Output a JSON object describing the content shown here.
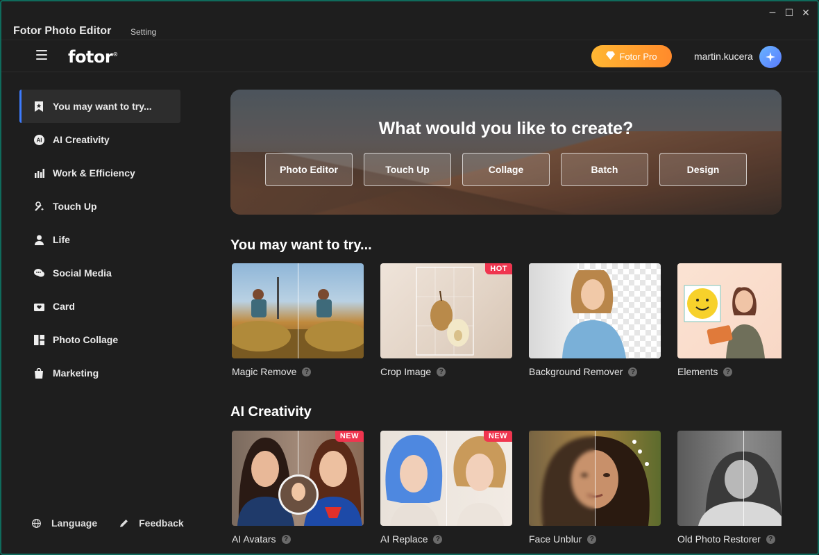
{
  "window": {
    "app_title": "Fotor Photo Editor",
    "setting_label": "Setting",
    "controls": {
      "minimize": "─",
      "maximize": "☐",
      "close": "✕"
    }
  },
  "header": {
    "logo": "fotor",
    "logo_mark": "®",
    "pro_button": "Fotor Pro",
    "username": "martin.kucera"
  },
  "sidebar": {
    "items": [
      {
        "label": "You may want to try...",
        "icon": "bookmark-star-icon",
        "active": true
      },
      {
        "label": "AI Creativity",
        "icon": "ai-icon"
      },
      {
        "label": "Work & Efficiency",
        "icon": "bar-chart-icon"
      },
      {
        "label": "Touch Up",
        "icon": "magic-wand-icon"
      },
      {
        "label": "Life",
        "icon": "person-icon"
      },
      {
        "label": "Social Media",
        "icon": "chat-bubbles-icon"
      },
      {
        "label": "Card",
        "icon": "card-icon"
      },
      {
        "label": "Photo Collage",
        "icon": "collage-icon"
      },
      {
        "label": "Marketing",
        "icon": "shopping-bag-icon"
      }
    ],
    "language": "Language",
    "feedback": "Feedback"
  },
  "hero": {
    "title": "What would you like to create?",
    "buttons": [
      "Photo Editor",
      "Touch Up",
      "Collage",
      "Batch",
      "Design"
    ]
  },
  "sections": [
    {
      "title": "You may want to try...",
      "cards": [
        {
          "label": "Magic Remove",
          "badge": ""
        },
        {
          "label": "Crop Image",
          "badge": "HOT"
        },
        {
          "label": "Background Remover",
          "badge": ""
        },
        {
          "label": "Elements",
          "badge": ""
        }
      ]
    },
    {
      "title": "AI Creativity",
      "cards": [
        {
          "label": "AI Avatars",
          "badge": "NEW"
        },
        {
          "label": "AI Replace",
          "badge": "NEW"
        },
        {
          "label": "Face Unblur",
          "badge": ""
        },
        {
          "label": "Old Photo Restorer",
          "badge": ""
        }
      ]
    }
  ],
  "help_glyph": "?",
  "colors": {
    "accent_active": "#3d7cff",
    "pro_gradient_start": "#ffb733",
    "pro_gradient_end": "#ff8a2b",
    "badge": "#f0354f",
    "background": "#1e1e1e"
  }
}
